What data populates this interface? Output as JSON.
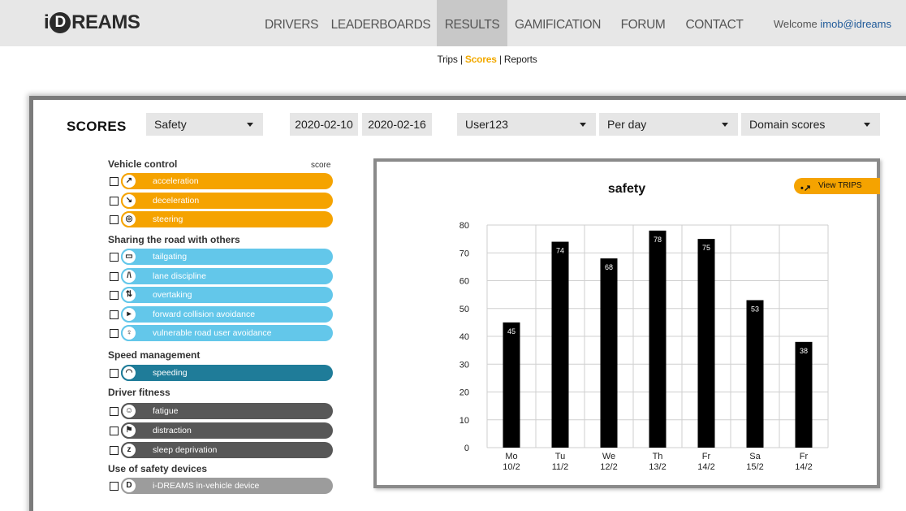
{
  "app": {
    "logo_text": "iDREAMS"
  },
  "nav": {
    "items": [
      {
        "label": "DRIVERS",
        "active": false
      },
      {
        "label": "LEADERBOARDS",
        "active": false
      },
      {
        "label": "RESULTS",
        "active": true
      },
      {
        "label": "GAMIFICATION",
        "active": false
      },
      {
        "label": "FORUM",
        "active": false
      },
      {
        "label": "CONTACT",
        "active": false
      }
    ],
    "welcome_prefix": "Welcome ",
    "welcome_user": "imob@idreams"
  },
  "subnav": {
    "trips": "Trips",
    "sep1": " | ",
    "scores": "Scores",
    "sep2": " | ",
    "reports": "Reports"
  },
  "scores": {
    "title": "SCORES",
    "domain_select": "Safety",
    "date_from": "2020-02-10",
    "date_to": "2020-02-16",
    "user_select": "User123",
    "period_select": "Per day",
    "mode_select": "Domain scores",
    "score_column_label": "score"
  },
  "categories": {
    "vehicle_control": "Vehicle control",
    "sharing_road": "Sharing the road with others",
    "speed_management": "Speed management",
    "driver_fitness": "Driver fitness",
    "safety_devices": "Use of safety devices"
  },
  "indicators": {
    "acceleration": {
      "label": "acceleration",
      "icon": "acceleration-icon",
      "color": "#f5a300"
    },
    "deceleration": {
      "label": "deceleration",
      "icon": "deceleration-icon",
      "color": "#f5a300"
    },
    "steering": {
      "label": "steering",
      "icon": "steering-icon",
      "color": "#f5a300"
    },
    "tailgating": {
      "label": "tailgating",
      "icon": "tailgating-icon",
      "color": "#63c7ea"
    },
    "lane_discipline": {
      "label": "lane discipline",
      "icon": "lane-icon",
      "color": "#63c7ea"
    },
    "overtaking": {
      "label": "overtaking",
      "icon": "overtaking-icon",
      "color": "#63c7ea"
    },
    "forward_collision": {
      "label": "forward collision avoidance",
      "icon": "forward-collision-icon",
      "color": "#63c7ea"
    },
    "vulnerable_road_user": {
      "label": "vulnerable road user avoidance",
      "icon": "pedestrian-icon",
      "color": "#63c7ea"
    },
    "speeding": {
      "label": "speeding",
      "icon": "speedometer-icon",
      "color": "#1f7c99"
    },
    "fatigue": {
      "label": "fatigue",
      "icon": "fatigue-icon",
      "color": "#575757"
    },
    "distraction": {
      "label": "distraction",
      "icon": "distraction-icon",
      "color": "#575757"
    },
    "sleep_deprivation": {
      "label": "sleep deprivation",
      "icon": "sleep-icon",
      "color": "#575757"
    },
    "in_vehicle_device": {
      "label": "i-DREAMS in-vehicle device",
      "icon": "device-icon",
      "color": "#9c9c9c"
    }
  },
  "chart_panel": {
    "view_trips_label": "View TRIPS"
  },
  "chart_data": {
    "type": "bar",
    "title": "safety",
    "categories": [
      "Mo\n10/2",
      "Tu\n11/2",
      "We\n12/2",
      "Th\n13/2",
      "Fr\n14/2",
      "Sa\n15/2",
      "Fr\n14/2"
    ],
    "category_day": [
      "Mo",
      "Tu",
      "We",
      "Th",
      "Fr",
      "Sa",
      "Fr"
    ],
    "category_date": [
      "10/2",
      "11/2",
      "12/2",
      "13/2",
      "14/2",
      "15/2",
      "14/2"
    ],
    "values": [
      45,
      74,
      68,
      78,
      75,
      53,
      38
    ],
    "ylim": [
      0,
      80
    ],
    "yticks": [
      0,
      10,
      20,
      30,
      40,
      50,
      60,
      70,
      80
    ],
    "bar_color": "#000000",
    "grid": true,
    "xlabel": "",
    "ylabel": ""
  }
}
